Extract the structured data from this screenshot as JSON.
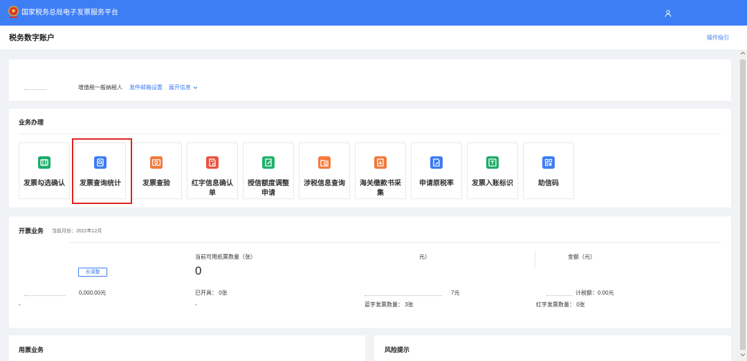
{
  "colors": {
    "brand_blue": "#3d7ef4",
    "link_blue": "#3b7cf0",
    "highlight_red": "#e02020",
    "page_background": "#f0f2f5"
  },
  "header": {
    "platform_title": "国家税务总局电子发票服务平台",
    "emblem_icon": "national-emblem-icon",
    "user_icon": "user-icon"
  },
  "subheader": {
    "page_title": "税务数字账户",
    "guide_link": "操作指引"
  },
  "taxpayer_card": {
    "taxpayer_type": "增值税一般纳税人",
    "mail_settings_link": "发件邮箱设置",
    "expand_info_link": "展开信息",
    "expand_icon": "chevron-down-icon"
  },
  "business": {
    "title": "业务办理",
    "highlighted_tile_index": 1,
    "tiles": [
      {
        "label": "发票勾选确认",
        "icon": "invoice-check-icon",
        "color": "#19ad69"
      },
      {
        "label": "发票查询统计",
        "icon": "invoice-search-icon",
        "color": "#3b7cf4"
      },
      {
        "label": "发票查验",
        "icon": "invoice-verify-icon",
        "color": "#f07a3b"
      },
      {
        "label": "红字信息确认单",
        "icon": "red-letter-confirm-icon",
        "color": "#e9543f"
      },
      {
        "label": "授信额度调整申请",
        "icon": "credit-adjust-icon",
        "color": "#1eb26a"
      },
      {
        "label": "涉税信息查询",
        "icon": "tax-info-query-icon",
        "color": "#f47b3a"
      },
      {
        "label": "海关缴款书采集",
        "icon": "customs-collection-icon",
        "color": "#f07a3b"
      },
      {
        "label": "申请原税率",
        "icon": "rate-apply-icon",
        "color": "#3b7cf5"
      },
      {
        "label": "发票入账标识",
        "icon": "bookkeeping-mark-icon",
        "color": "#1eab69"
      },
      {
        "label": "助信码",
        "icon": "credit-code-icon",
        "color": "#3d7ef5"
      }
    ]
  },
  "invoicing": {
    "title": "开票业务",
    "current_month": "当前月份：2022年12月",
    "adjust_button": "去调整",
    "columns": [
      {
        "amount": "0,000.00元",
        "footer": "-"
      },
      {
        "header": "当前可用纸票数量（张）",
        "big_value": "0",
        "issued": "已开具： 0张",
        "footer": "-"
      },
      {
        "header": "元）",
        "amount": "7元",
        "footer": "蓝字发票数量： 3张"
      },
      {
        "header": "金额（元）",
        "amount": "计税额：0.00元",
        "footer": "红字发票数量： 0张"
      }
    ]
  },
  "bottom": {
    "ticket_business_title": "用票业务",
    "risk_title": "风险提示"
  }
}
